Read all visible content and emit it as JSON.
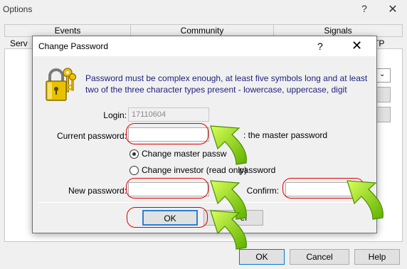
{
  "options_window": {
    "title": "Options",
    "help_glyph": "?",
    "close_glyph": "✕",
    "tabs_top": [
      "Events",
      "Community",
      "Signals"
    ],
    "tabs_bottom_left": "Serv",
    "tabs_bottom_right": "TP",
    "buttons": {
      "ok": "OK",
      "cancel": "Cancel",
      "help": "Help"
    }
  },
  "dialog": {
    "title": "Change Password",
    "help_glyph": "?",
    "close_glyph": "✕",
    "message": "Password must be complex enough, at least five symbols long and at least two of the three character types present - lowercase, uppercase, digit",
    "login_label": "Login:",
    "login_value": "17110604",
    "current_password_label": "Current password:",
    "current_password_hint": ": the master password",
    "radio_master": "Change master passw",
    "radio_investor": "Change investor (read only)",
    "radio_investor_tail": "password",
    "new_password_label": "New password:",
    "confirm_label": "Confirm:",
    "ok_label": "OK",
    "cancel_fragment": "el"
  },
  "colors": {
    "highlight": "#e00000",
    "arrow_green": "#8fd400",
    "message_text": "#1f1f7f"
  }
}
